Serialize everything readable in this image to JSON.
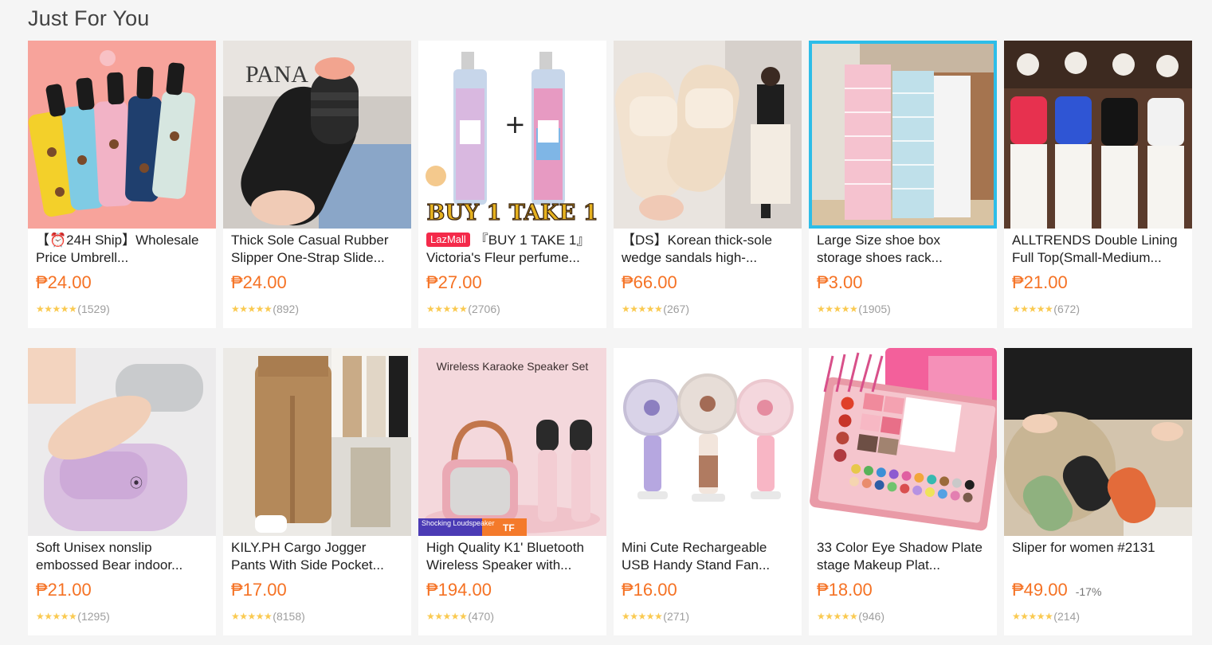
{
  "section": {
    "title": "Just For You"
  },
  "products": [
    {
      "title": "【⏰24H Ship】Wholesale Price Umbrell...",
      "price": "₱24.00",
      "reviews": "(1529)"
    },
    {
      "title": "Thick Sole Casual Rubber Slipper One-Strap Slide...",
      "price": "₱24.00",
      "reviews": "(892)"
    },
    {
      "badge": "LazMall",
      "title": "『BUY 1 TAKE 1』Victoria's Fleur perfume...",
      "price": "₱27.00",
      "reviews": "(2706)",
      "image_text": "BUY 1 TAKE 1"
    },
    {
      "title": "【DS】Korean thick-sole wedge sandals high-...",
      "price": "₱66.00",
      "reviews": "(267)"
    },
    {
      "title": "Large Size shoe box storage shoes rack...",
      "price": "₱3.00",
      "reviews": "(1905)"
    },
    {
      "title": "ALLTRENDS Double Lining Full Top(Small-Medium...",
      "price": "₱21.00",
      "reviews": "(672)"
    },
    {
      "title": "Soft Unisex nonslip embossed Bear indoor...",
      "price": "₱21.00",
      "reviews": "(1295)"
    },
    {
      "title": "KILY.PH Cargo Jogger Pants With Side Pocket...",
      "price": "₱17.00",
      "reviews": "(8158)"
    },
    {
      "title": "High Quality K1' Bluetooth Wireless Speaker with...",
      "price": "₱194.00",
      "reviews": "(470)",
      "image_text": "Wireless Karaoke Speaker Set",
      "image_tag": "Shocking Loudspeaker",
      "image_tag2": "TF"
    },
    {
      "title": "Mini Cute Rechargeable USB Handy Stand Fan...",
      "price": "₱16.00",
      "reviews": "(271)"
    },
    {
      "title": "33 Color Eye Shadow Plate stage Makeup Plat...",
      "price": "₱18.00",
      "reviews": "(946)"
    },
    {
      "title": "Sliper for women #2131",
      "price": "₱49.00",
      "discount": "-17%",
      "reviews": "(214)"
    }
  ],
  "colors": {
    "price": "#f57224",
    "star": "#faca51",
    "lazmall": "#f42a4a"
  },
  "icons": {
    "star": "★"
  }
}
